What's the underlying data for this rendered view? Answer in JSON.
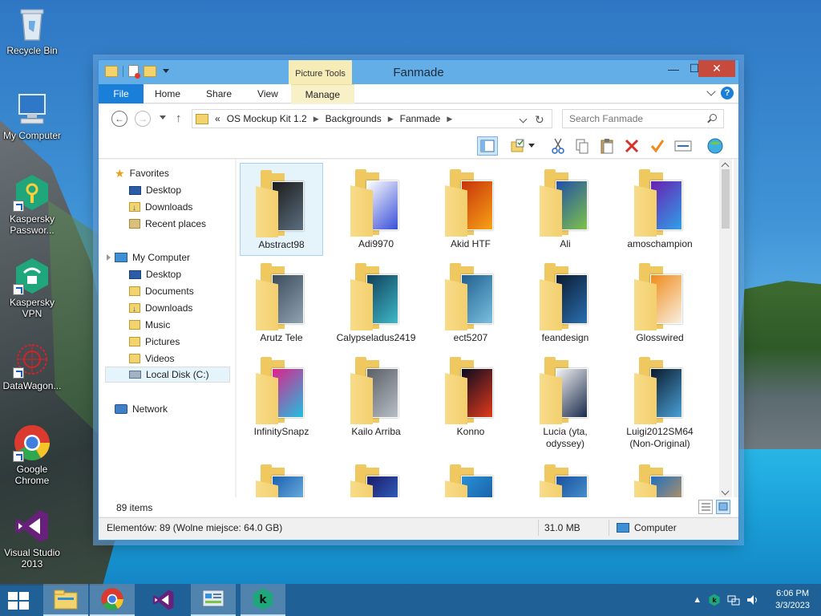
{
  "desktop": {
    "icons": [
      {
        "label": "Recycle Bin"
      },
      {
        "label": "My Computer"
      },
      {
        "label": "Kaspersky Passwor..."
      },
      {
        "label": "Kaspersky VPN"
      },
      {
        "label": "DataWagon..."
      },
      {
        "label": "Google Chrome"
      },
      {
        "label": "Visual Studio 2013"
      }
    ]
  },
  "window": {
    "title": "Fanmade",
    "contextual_tab_group": "Picture Tools",
    "tabs": [
      "File",
      "Home",
      "Share",
      "View",
      "Manage"
    ],
    "help_label": "?",
    "minimize_label": "—",
    "maximize_label": "☐",
    "close_label": "✕"
  },
  "address": {
    "prefix": "«",
    "crumbs": [
      "OS Mockup Kit 1.2",
      "Backgrounds",
      "Fanmade"
    ],
    "search_placeholder": "Search Fanmade"
  },
  "navpane": {
    "favorites": "Favorites",
    "favorites_items": [
      "Desktop",
      "Downloads",
      "Recent places"
    ],
    "computer": "My Computer",
    "computer_items": [
      "Desktop",
      "Documents",
      "Downloads",
      "Music",
      "Pictures",
      "Videos",
      "Local Disk (C:)"
    ],
    "network": "Network"
  },
  "files": [
    {
      "name": "Abstract98",
      "thumb": "#1b1b1b",
      "thumb2": "#5b6f80"
    },
    {
      "name": "Adi9970",
      "thumb": "#ffffff",
      "thumb2": "#3a4fd8"
    },
    {
      "name": "Akid HTF",
      "thumb": "#c8320a",
      "thumb2": "#f7a216"
    },
    {
      "name": "Ali",
      "thumb": "#1f4fa8",
      "thumb2": "#7fc24a"
    },
    {
      "name": "amoschampion",
      "thumb": "#6a1fb0",
      "thumb2": "#2fa0e8"
    },
    {
      "name": "Arutz Tele",
      "thumb": "#3b4b5a",
      "thumb2": "#8fa3b3"
    },
    {
      "name": "Calypseladus2419",
      "thumb": "#0f3f5a",
      "thumb2": "#3fb8c8"
    },
    {
      "name": "ect5207",
      "thumb": "#1f5f8f",
      "thumb2": "#7ac0e0"
    },
    {
      "name": "feandesign",
      "thumb": "#0b1a30",
      "thumb2": "#2a6fb0"
    },
    {
      "name": "Glosswired",
      "thumb": "#f08a1a",
      "thumb2": "#f8f0e0"
    },
    {
      "name": "InfinitySnapz",
      "thumb": "#e0208a",
      "thumb2": "#20c0e0"
    },
    {
      "name": "Kailo Arriba",
      "thumb": "#5a5f66",
      "thumb2": "#b8bec6"
    },
    {
      "name": "Konno",
      "thumb": "#0a0a20",
      "thumb2": "#e03a1a"
    },
    {
      "name": "Lucia (yta, odyssey)",
      "thumb": "#f4f4f4",
      "thumb2": "#1a2a4a"
    },
    {
      "name": "Luigi2012SM64 (Non-Original)",
      "thumb": "#0a1a2a",
      "thumb2": "#4aa0d8"
    },
    {
      "name": "",
      "thumb": "#1a60b0",
      "thumb2": "#8fd0f0"
    },
    {
      "name": "",
      "thumb": "#1a1a6a",
      "thumb2": "#3a7fe0"
    },
    {
      "name": "",
      "thumb": "#2a8fd8",
      "thumb2": "#0f4f8f"
    },
    {
      "name": "",
      "thumb": "#1a4f9f",
      "thumb2": "#5ab0e0"
    },
    {
      "name": "",
      "thumb": "#1f6fc0",
      "thumb2": "#f0a040"
    }
  ],
  "status": {
    "items_count": "89 items",
    "left": "Elementów: 89 (Wolne miejsce: 64.0 GB)",
    "size": "31.0 MB",
    "location": "Computer"
  },
  "taskbar": {
    "time": "6:06 PM",
    "date": "3/3/2023"
  }
}
